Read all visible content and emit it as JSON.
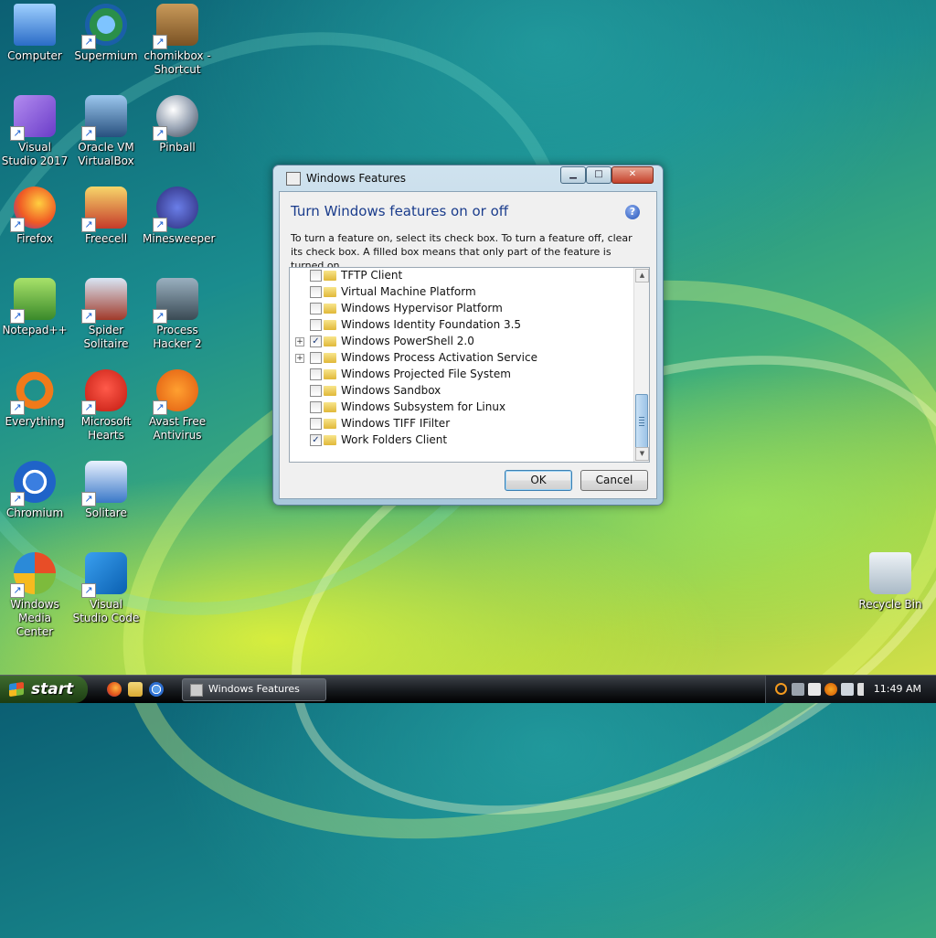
{
  "desktop": {
    "icons": [
      {
        "label": "Computer",
        "name": "computer-icon"
      },
      {
        "label": "Supermium",
        "name": "supermium-icon"
      },
      {
        "label": "chomikbox - Shortcut",
        "name": "chomikbox-icon"
      },
      {
        "label": "Visual Studio 2017",
        "name": "visual-studio-2017-icon"
      },
      {
        "label": "Oracle VM VirtualBox",
        "name": "virtualbox-icon"
      },
      {
        "label": "Pinball",
        "name": "pinball-icon"
      },
      {
        "label": "Firefox",
        "name": "firefox-icon"
      },
      {
        "label": "Freecell",
        "name": "freecell-icon"
      },
      {
        "label": "Minesweeper",
        "name": "minesweeper-icon"
      },
      {
        "label": "Notepad++",
        "name": "notepadpp-icon"
      },
      {
        "label": "Spider Solitaire",
        "name": "spider-solitaire-icon"
      },
      {
        "label": "Process Hacker 2",
        "name": "process-hacker-icon"
      },
      {
        "label": "Everything",
        "name": "everything-icon"
      },
      {
        "label": "Microsoft Hearts",
        "name": "hearts-icon"
      },
      {
        "label": "Avast Free Antivirus",
        "name": "avast-icon"
      },
      {
        "label": "Chromium",
        "name": "chromium-icon"
      },
      {
        "label": "Solitare",
        "name": "solitaire-icon"
      },
      {
        "label": "Windows Media Center",
        "name": "media-center-icon"
      },
      {
        "label": "Visual Studio Code",
        "name": "vscode-icon"
      },
      {
        "label": "Recycle Bin",
        "name": "recycle-bin-icon"
      }
    ]
  },
  "dialog": {
    "title": "Windows Features",
    "heading": "Turn Windows features on or off",
    "description": "To turn a feature on, select its check box. To turn a feature off, clear its check box. A filled box means that only part of the feature is turned on.",
    "features": [
      {
        "label": "TFTP Client",
        "checked": false,
        "expandable": false
      },
      {
        "label": "Virtual Machine Platform",
        "checked": false,
        "expandable": false
      },
      {
        "label": "Windows Hypervisor Platform",
        "checked": false,
        "expandable": false
      },
      {
        "label": "Windows Identity Foundation 3.5",
        "checked": false,
        "expandable": false
      },
      {
        "label": "Windows PowerShell 2.0",
        "checked": true,
        "expandable": true
      },
      {
        "label": "Windows Process Activation Service",
        "checked": false,
        "expandable": true
      },
      {
        "label": "Windows Projected File System",
        "checked": false,
        "expandable": false
      },
      {
        "label": "Windows Sandbox",
        "checked": false,
        "expandable": false
      },
      {
        "label": "Windows Subsystem for Linux",
        "checked": false,
        "expandable": false
      },
      {
        "label": "Windows TIFF IFilter",
        "checked": false,
        "expandable": false
      },
      {
        "label": "Work Folders Client",
        "checked": true,
        "expandable": false
      }
    ],
    "ok_label": "OK",
    "cancel_label": "Cancel",
    "help_glyph": "?"
  },
  "taskbar": {
    "start_label": "start",
    "task_button_label": "Windows Features",
    "clock": "11:49 AM"
  }
}
